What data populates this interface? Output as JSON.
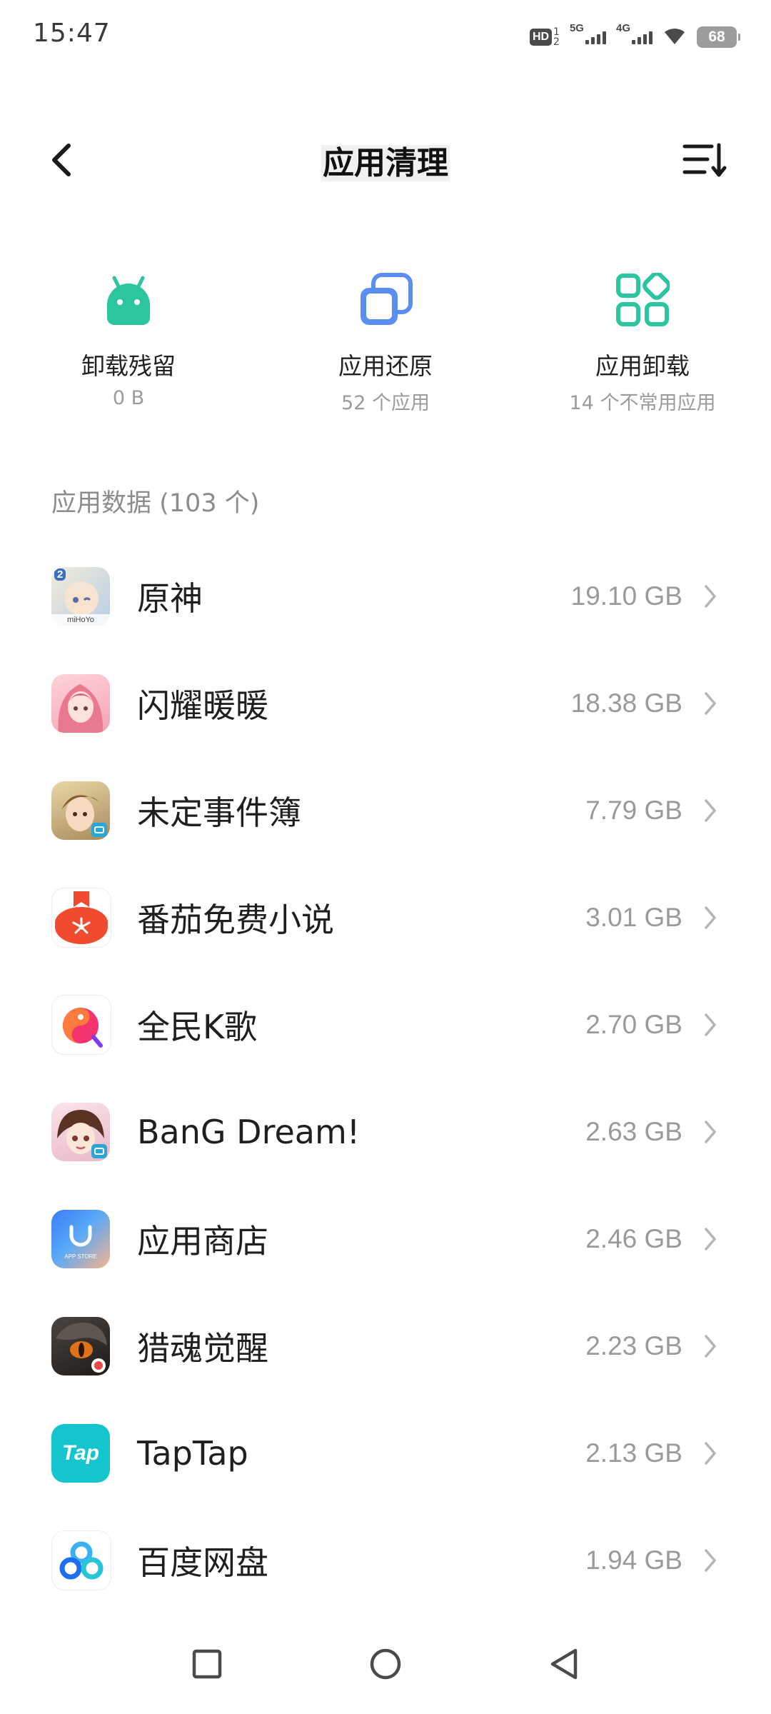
{
  "status_bar": {
    "time": "15:47",
    "hd_label": "HD",
    "hd_sub_top": "1",
    "hd_sub_bottom": "2",
    "net1_label": "5G",
    "net2_label": "4G",
    "battery": "68"
  },
  "header": {
    "title": "应用清理"
  },
  "shortcuts": [
    {
      "title": "卸载残留",
      "subtitle": "0 B",
      "icon": "android-icon",
      "color": "#2bc5a0"
    },
    {
      "title": "应用还原",
      "subtitle": "52 个应用",
      "icon": "copy-icon",
      "color": "#5a8ef0"
    },
    {
      "title": "应用卸载",
      "subtitle": "14 个不常用应用",
      "icon": "apps-grid-icon",
      "color": "#2bc5a0"
    }
  ],
  "section": {
    "title": "应用数据 (103 个)"
  },
  "apps": [
    {
      "name": "原神",
      "size": "19.10 GB"
    },
    {
      "name": "闪耀暖暖",
      "size": "18.38 GB"
    },
    {
      "name": "未定事件簿",
      "size": "7.79 GB"
    },
    {
      "name": "番茄免费小说",
      "size": "3.01 GB"
    },
    {
      "name": "全民K歌",
      "size": "2.70 GB"
    },
    {
      "name": "BanG Dream!",
      "size": "2.63 GB"
    },
    {
      "name": "应用商店",
      "size": "2.46 GB"
    },
    {
      "name": "猎魂觉醒",
      "size": "2.23 GB"
    },
    {
      "name": "TapTap",
      "size": "2.13 GB"
    },
    {
      "name": "百度网盘",
      "size": "1.94 GB"
    }
  ],
  "icon_texts": {
    "genshin_badge": "2",
    "genshin_brand": "miHoYo",
    "appstore_label": "APP STORE",
    "taptap_label": "Tap"
  },
  "colors": {
    "accent_green": "#2bc5a0",
    "accent_blue": "#5a8ef0"
  }
}
